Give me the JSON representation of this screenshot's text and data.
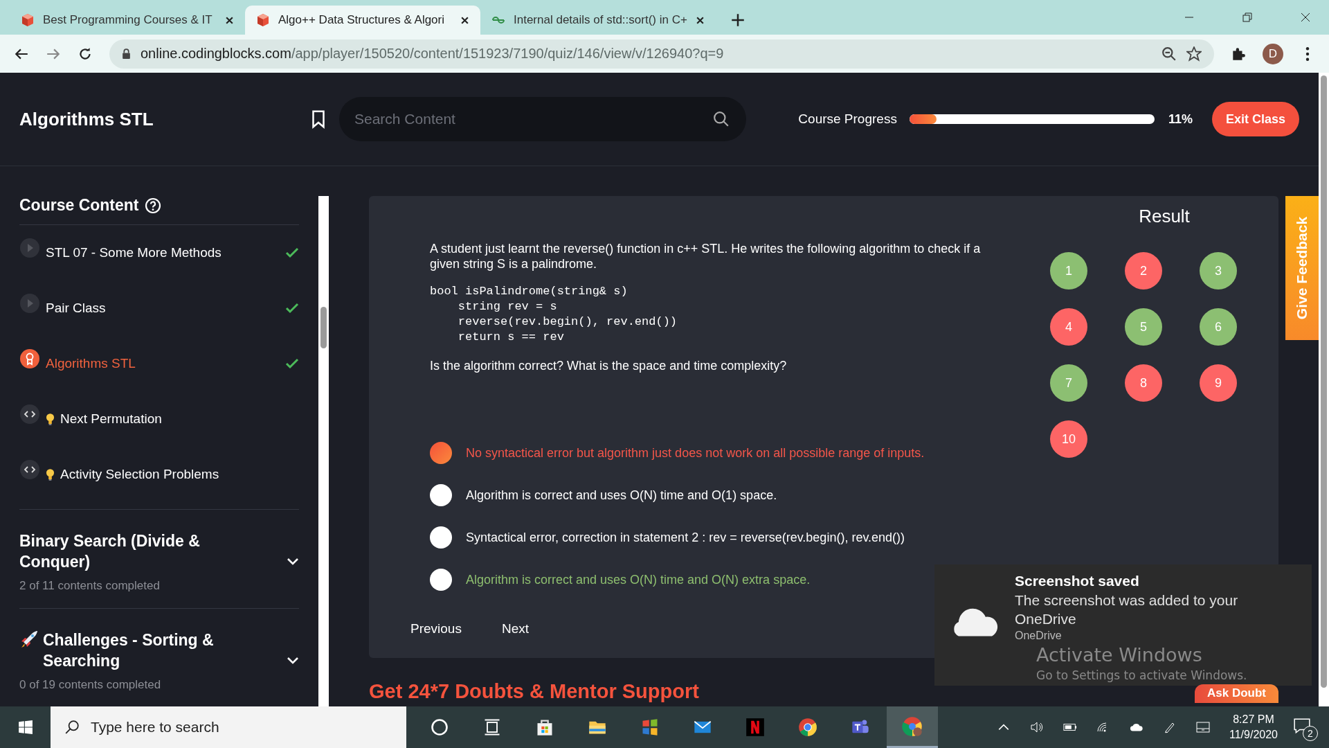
{
  "browser": {
    "tabs": [
      {
        "title": "Best Programming Courses & IT",
        "selected": false,
        "kind": "cube"
      },
      {
        "title": "Algo++ Data Structures & Algori",
        "selected": true,
        "kind": "cube"
      },
      {
        "title": "Internal details of std::sort() in C+",
        "selected": false,
        "kind": "gfg"
      }
    ],
    "url_domain": "online.codingblocks.com",
    "url_path": "/app/player/150520/content/151923/7190/quiz/146/view/v/126940?q=9",
    "profile": "D"
  },
  "header": {
    "title": "Algorithms STL",
    "search": {
      "placeholder": "Search Content"
    },
    "progress_label": "Course Progress",
    "progress": {
      "level": 0.11
    },
    "progress_text": "11%",
    "exit_button": "Exit Class"
  },
  "sidebar": {
    "heading": "Course Content",
    "items": [
      {
        "kind": "video",
        "label": "STL 07 - Some More Methods",
        "done": true,
        "selected": false
      },
      {
        "kind": "video",
        "label": "Pair Class",
        "done": true,
        "selected": false
      },
      {
        "kind": "quiz",
        "label": "Algorithms STL",
        "done": true,
        "selected": true
      },
      {
        "kind": "code",
        "label": "Next Permutation",
        "done": false,
        "selected": false
      },
      {
        "kind": "code",
        "label": "Activity Selection Problems",
        "done": false,
        "selected": false
      }
    ],
    "sections": [
      {
        "kind": "plain",
        "title": "Binary Search (Divide & Conquer)",
        "progress": "2 of 11 contents completed",
        "expanded": false
      },
      {
        "kind": "challenge",
        "title": "Challenges - Sorting & Searching",
        "progress": "0 of 19 contents completed",
        "expanded": false
      }
    ]
  },
  "quiz": {
    "question": "A student just learnt the reverse() function in c++ STL. He writes the following algorithm to check if a given string S is a palindrome.",
    "code": [
      "bool isPalindrome(string& s)",
      "    string rev = s",
      "    reverse(rev.begin(), rev.end())",
      "    return s == rev"
    ],
    "prompt": "Is the algorithm correct? What is the space and time complexity?",
    "options": [
      {
        "text": "No syntactical error but algorithm just does not work on all possible range of inputs.",
        "selected": true,
        "correct": false
      },
      {
        "text": "Algorithm is correct and uses O(N) time and O(1) space.",
        "selected": false,
        "correct": false
      },
      {
        "text": "Syntactical error, correction in statement 2 : rev = reverse(rev.begin(), rev.end())",
        "selected": false,
        "correct": false
      },
      {
        "text": "Algorithm is correct and uses O(N) time and O(N) extra space.",
        "selected": false,
        "correct": true
      }
    ],
    "nav": [
      "Previous",
      "Next"
    ],
    "result_title": "Result",
    "results": [
      {
        "label": "1",
        "correct": true
      },
      {
        "label": "2",
        "correct": false
      },
      {
        "label": "3",
        "correct": true
      },
      {
        "label": "4",
        "correct": false
      },
      {
        "label": "5",
        "correct": true
      },
      {
        "label": "6",
        "correct": true
      },
      {
        "label": "7",
        "correct": true
      },
      {
        "label": "8",
        "correct": false
      },
      {
        "label": "9",
        "correct": false
      },
      {
        "label": "10",
        "correct": false
      }
    ]
  },
  "feedback_tab": "Give Feedback",
  "banner": "Get 24*7 Doubts & Mentor Support",
  "ask_doubt": "Ask Doubt",
  "notification": {
    "title": "Screenshot saved",
    "body": "The screenshot was added to your OneDrive",
    "app": "OneDrive"
  },
  "activation": {
    "title": "Activate Windows",
    "text": "Go to Settings to activate Windows."
  },
  "taskbar": {
    "search": {
      "placeholder": "Type here to search"
    },
    "time": "8:27 PM",
    "date": "11/9/2020",
    "notifications": "2"
  }
}
